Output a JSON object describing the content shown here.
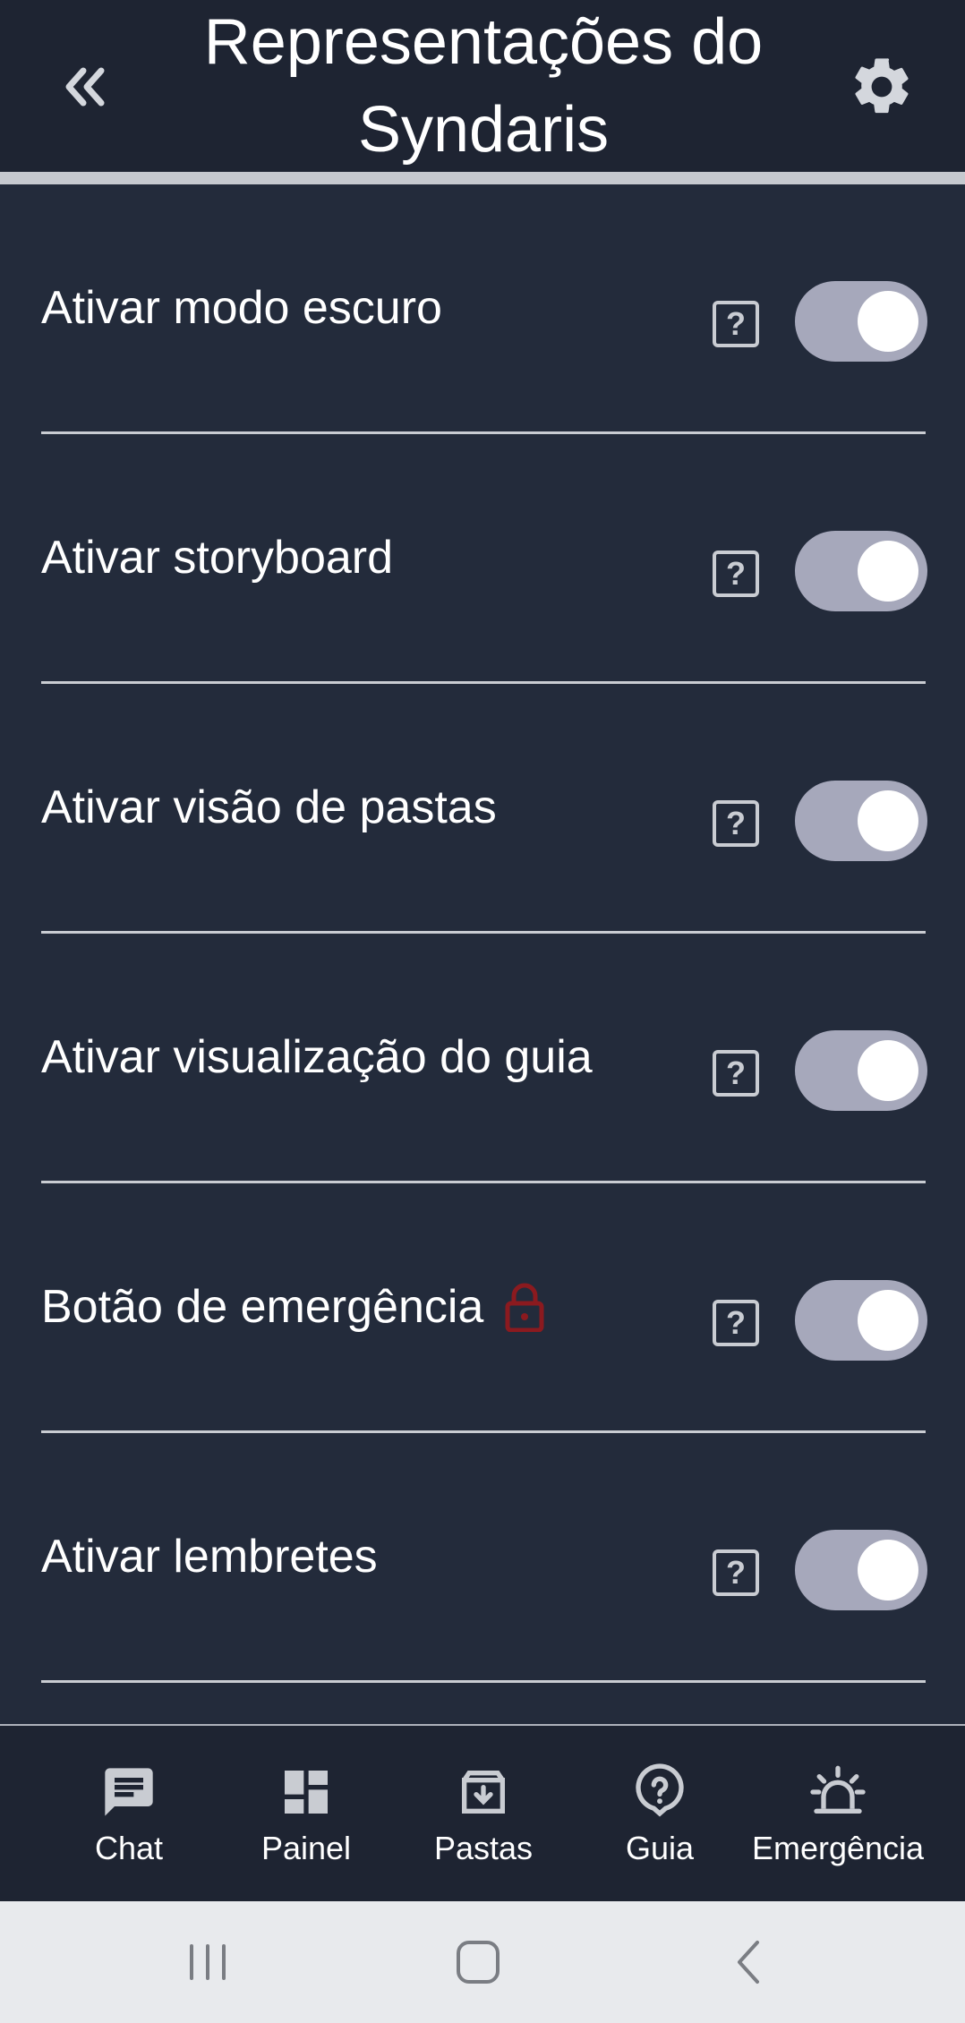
{
  "header": {
    "title": "Representações do Syndaris",
    "back_icon": "double-chevron-left-icon",
    "settings_icon": "gear-icon"
  },
  "settings": [
    {
      "label": "Ativar modo escuro",
      "enabled": true,
      "locked": false
    },
    {
      "label": "Ativar storyboard",
      "enabled": true,
      "locked": false
    },
    {
      "label": "Ativar visão de pastas",
      "enabled": true,
      "locked": false
    },
    {
      "label": "Ativar visualização do guia",
      "enabled": true,
      "locked": false
    },
    {
      "label": "Botão de emergência",
      "enabled": true,
      "locked": true
    },
    {
      "label": "Ativar lembretes",
      "enabled": true,
      "locked": false
    }
  ],
  "bottom_nav": {
    "items": [
      {
        "label": "Chat",
        "icon": "chat-icon"
      },
      {
        "label": "Painel",
        "icon": "dashboard-icon"
      },
      {
        "label": "Pastas",
        "icon": "archive-download-icon"
      },
      {
        "label": "Guia",
        "icon": "help-circle-icon"
      },
      {
        "label": "Emergência",
        "icon": "alarm-light-icon"
      }
    ]
  },
  "colors": {
    "background": "#232b3b",
    "header": "#1e2432",
    "toggle_track": "#a6a8bb",
    "lock": "#8b1a1f",
    "system_bar": "#e8eaed"
  }
}
